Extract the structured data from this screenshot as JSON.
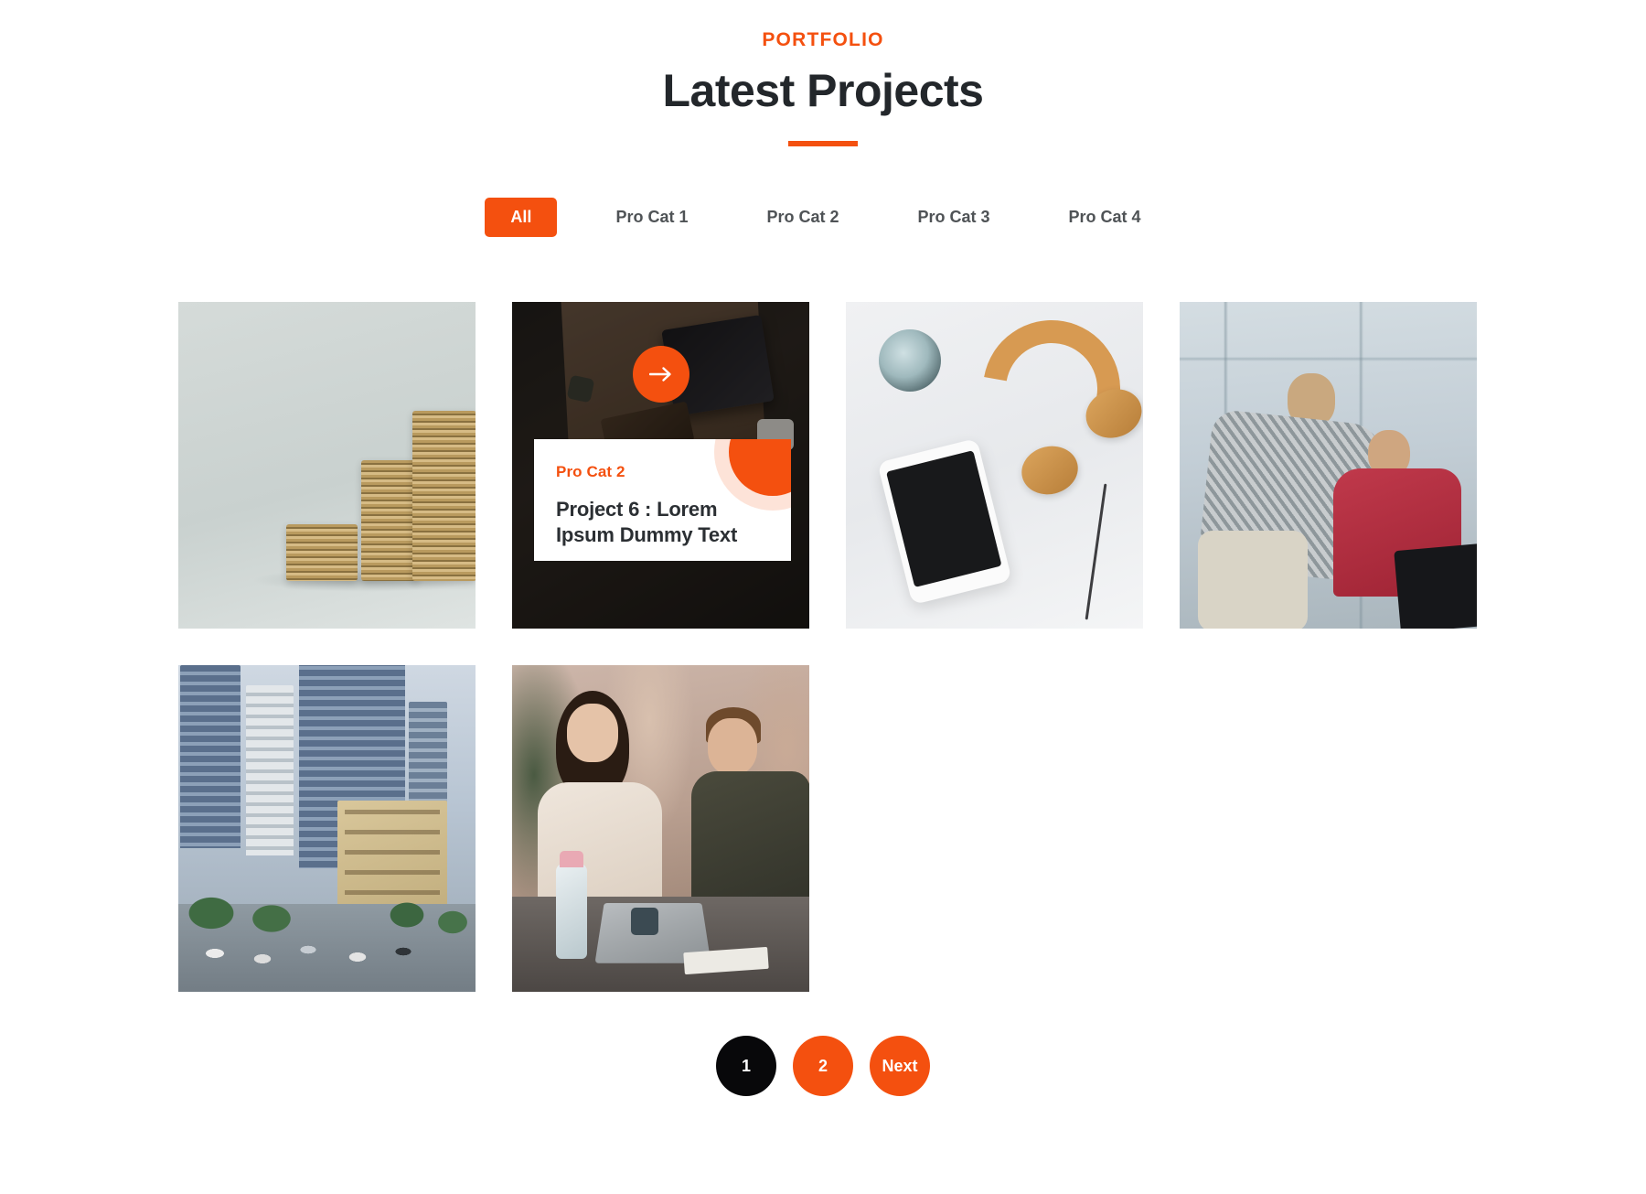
{
  "header": {
    "eyebrow": "PORTFOLIO",
    "title": "Latest Projects"
  },
  "filters": {
    "items": [
      {
        "label": "All",
        "active": true
      },
      {
        "label": "Pro Cat 1",
        "active": false
      },
      {
        "label": "Pro Cat 2",
        "active": false
      },
      {
        "label": "Pro Cat 3",
        "active": false
      },
      {
        "label": "Pro Cat 4",
        "active": false
      }
    ]
  },
  "projects": [
    {
      "image": "coins-stacked-photo",
      "featured": false
    },
    {
      "image": "dark-desk-flatlay-photo",
      "featured": true,
      "category": "Pro Cat 2",
      "title": "Project 6 : Lorem Ipsum Dummy Text",
      "arrow_icon": "arrow-right-icon"
    },
    {
      "image": "headphones-phone-flatlay-photo",
      "featured": false
    },
    {
      "image": "two-people-window-photo",
      "featured": false
    },
    {
      "image": "city-street-photo",
      "featured": false
    },
    {
      "image": "meeting-table-photo",
      "featured": false
    }
  ],
  "pagination": {
    "pages": [
      {
        "label": "1",
        "state": "current"
      },
      {
        "label": "2",
        "state": "idle"
      },
      {
        "label": "Next",
        "state": "next"
      }
    ]
  },
  "colors": {
    "accent": "#F4500F",
    "heading": "#23272b",
    "tab_inactive": "#4f5356",
    "current_page": "#08080a",
    "background": "#ffffff"
  }
}
